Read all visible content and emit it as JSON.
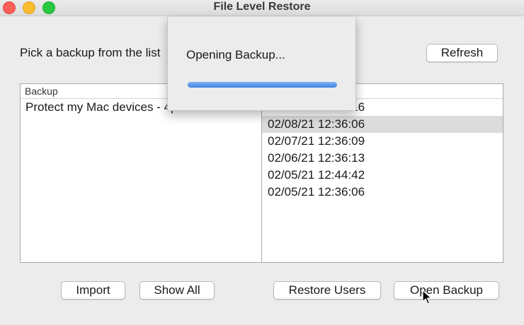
{
  "window": {
    "title": "File Level Restore"
  },
  "prompt": "Pick a backup from the list",
  "buttons": {
    "refresh": "Refresh",
    "import": "Import",
    "show_all": "Show All",
    "restore_users": "Restore Users",
    "open_backup": "Open Backup"
  },
  "backup_panel": {
    "header": "Backup",
    "items": [
      "Protect my Mac devices - 4p-4f2-00-C..."
    ]
  },
  "date_panel": {
    "partial_item": "02/09/21 12:36:16",
    "items": [
      {
        "label": "02/08/21 12:36:06",
        "selected": true
      },
      {
        "label": "02/07/21 12:36:09",
        "selected": false
      },
      {
        "label": "02/06/21 12:36:13",
        "selected": false
      },
      {
        "label": "02/05/21 12:44:42",
        "selected": false
      },
      {
        "label": "02/05/21 12:36:06",
        "selected": false
      }
    ]
  },
  "progress_dialog": {
    "message": "Opening Backup...",
    "progress_fraction": 1.0
  },
  "colors": {
    "progress_accent": "#3f84e5",
    "selected_row": "#dcdcdc",
    "close_button": "#fc5f57",
    "minimize_button": "#fdbc2e",
    "zoom_button": "#28c840"
  },
  "icons": {
    "pointer": "arrow-cursor-icon"
  }
}
